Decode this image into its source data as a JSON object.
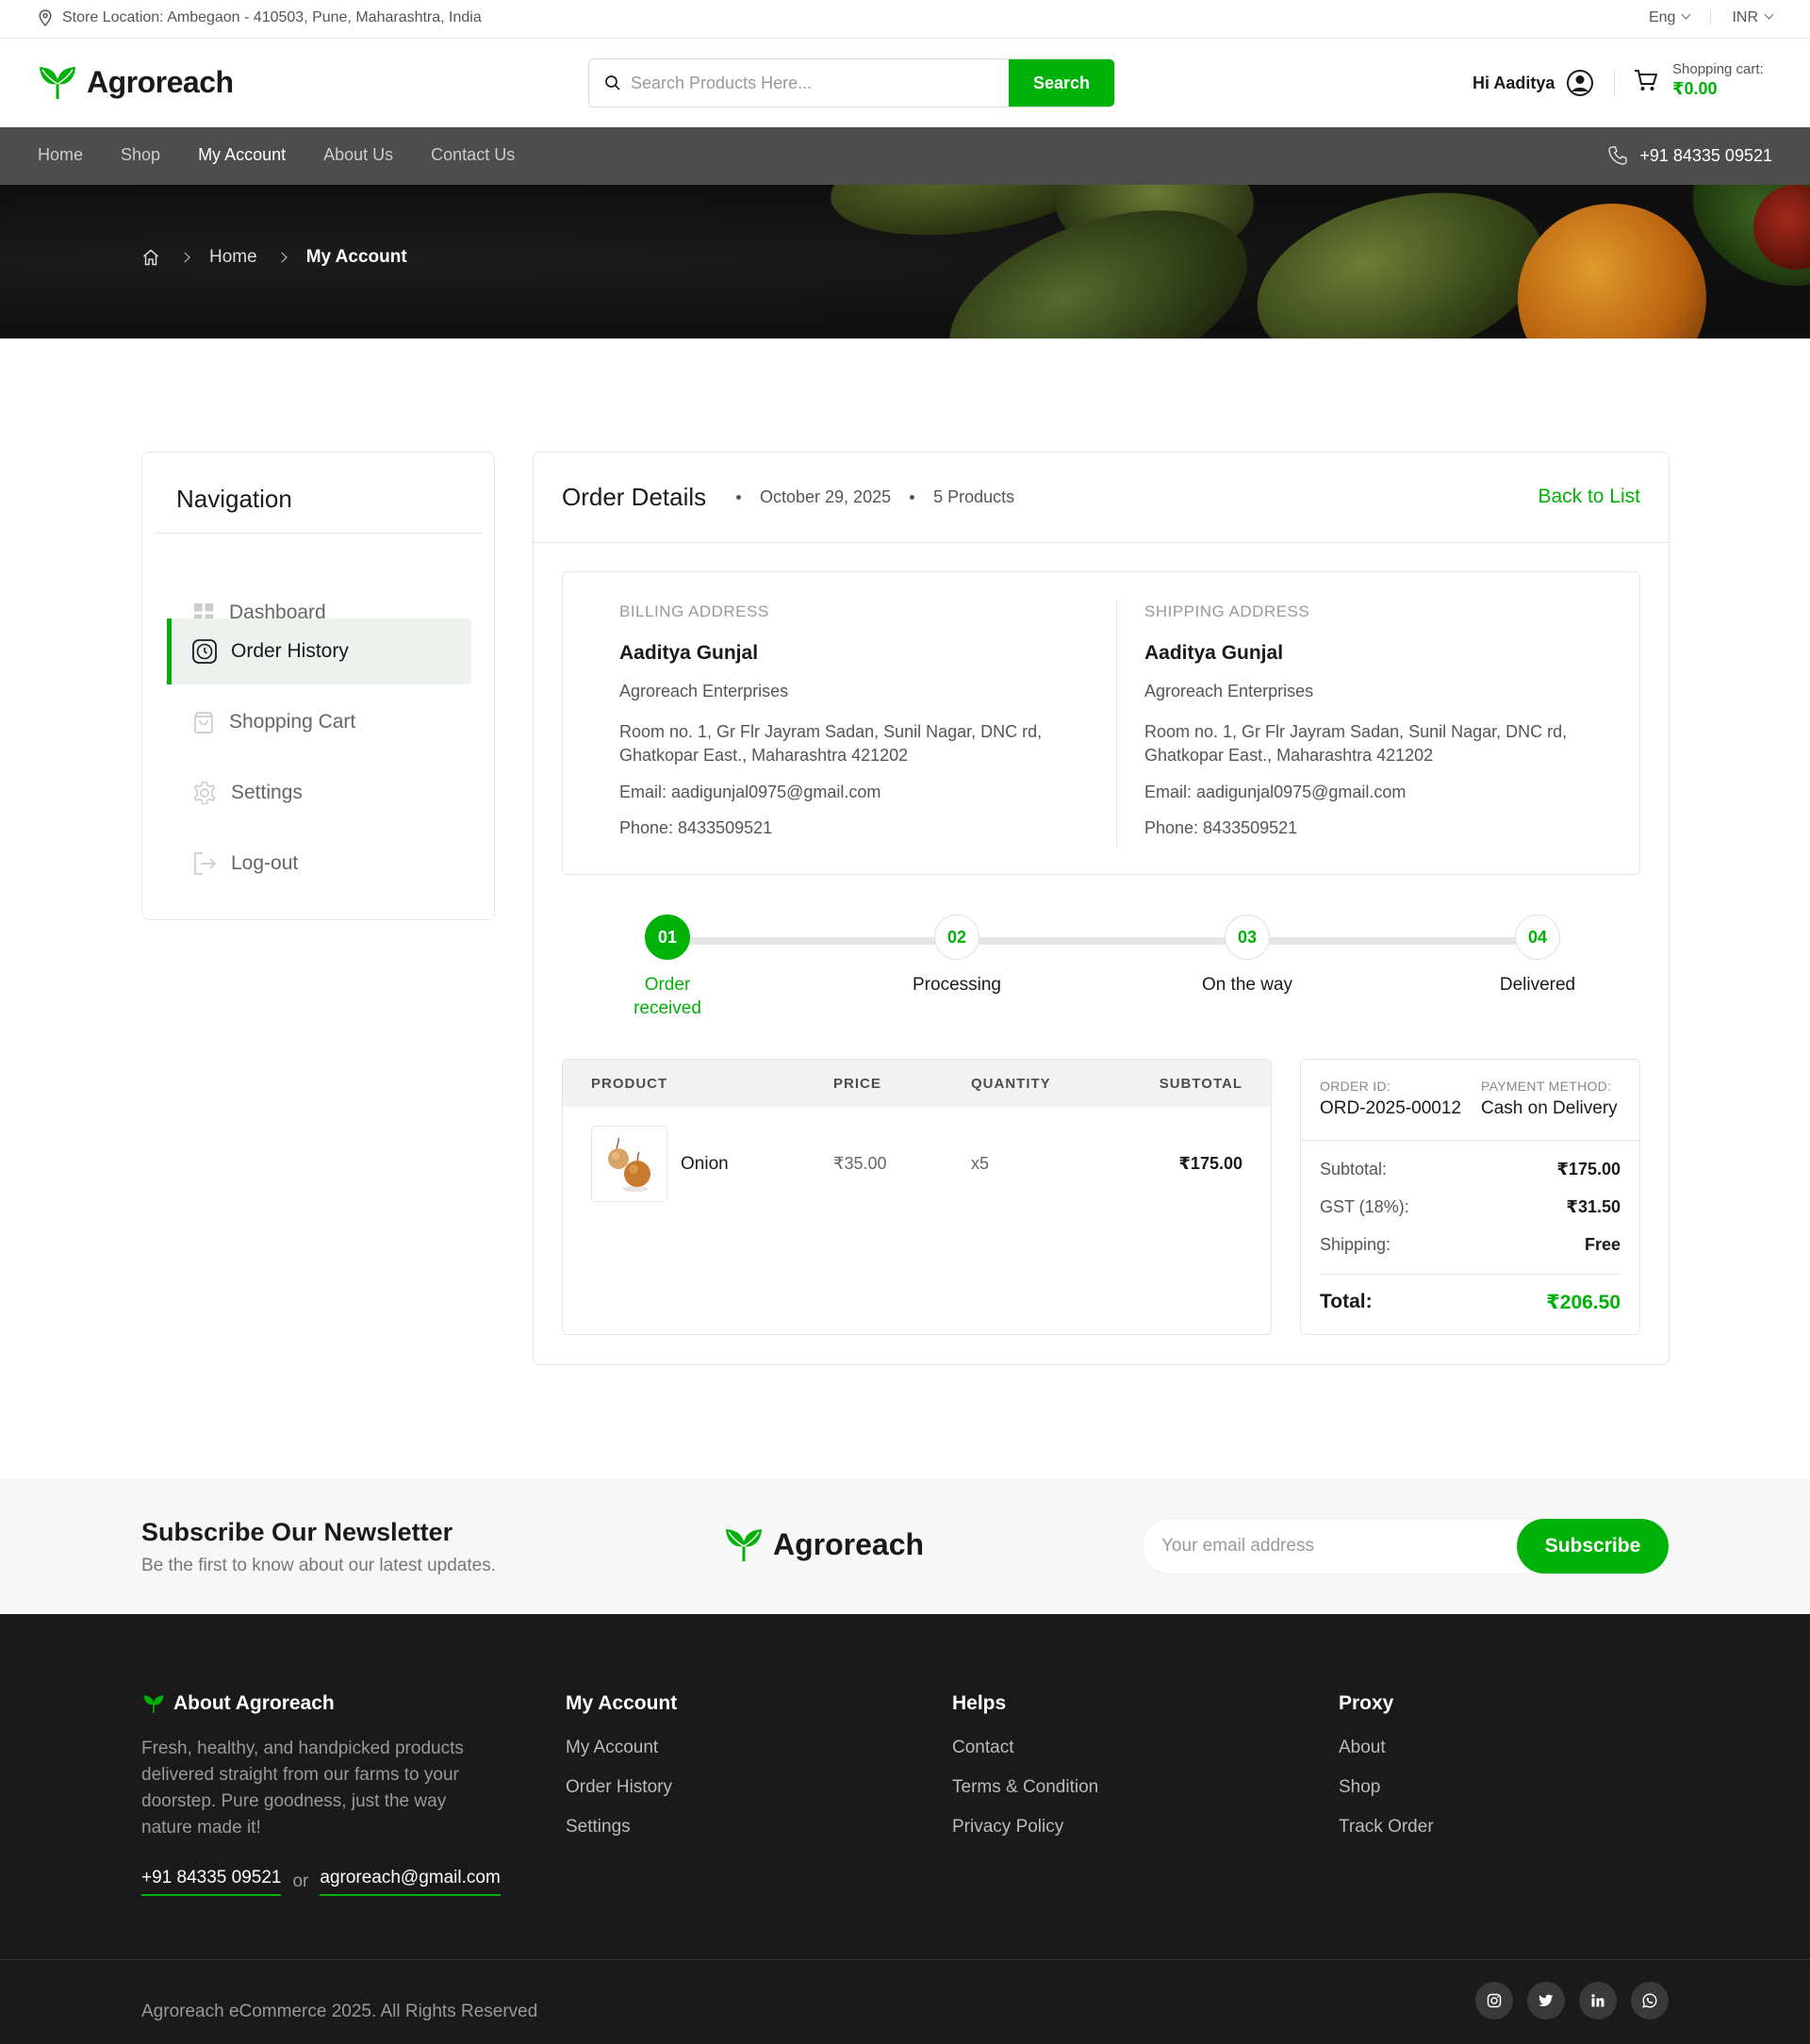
{
  "topbar": {
    "location": "Store Location: Ambegaon - 410503, Pune, Maharashtra, India",
    "language": "Eng",
    "currency": "INR"
  },
  "header": {
    "brand": "Agroreach",
    "search_placeholder": "Search Products Here...",
    "search_button": "Search",
    "greeting": "Hi Aaditya",
    "cart_label": "Shopping cart:",
    "cart_amount": "₹0.00"
  },
  "nav": {
    "links": [
      "Home",
      "Shop",
      "My Account",
      "About Us",
      "Contact Us"
    ],
    "active": "My Account",
    "phone": "+91 84335 09521"
  },
  "breadcrumb": {
    "home": "Home",
    "current": "My Account"
  },
  "sidebar": {
    "title": "Navigation",
    "items": [
      {
        "label": "Dashboard",
        "icon": "dashboard-icon"
      },
      {
        "label": "Order History",
        "icon": "clock-icon",
        "active": true
      },
      {
        "label": "Shopping Cart",
        "icon": "bag-icon"
      },
      {
        "label": "Settings",
        "icon": "gear-icon"
      },
      {
        "label": "Log-out",
        "icon": "logout-icon"
      }
    ]
  },
  "order": {
    "title": "Order Details",
    "date": "October 29, 2025",
    "products_count": "5 Products",
    "back_link": "Back to List",
    "billing": {
      "heading": "BILLING ADDRESS",
      "name": "Aaditya Gunjal",
      "company": "Agroreach Enterprises",
      "address": "Room no. 1, Gr Flr Jayram Sadan, Sunil Nagar, DNC rd, Ghatkopar East., Maharashtra 421202",
      "email": "Email: aadigunjal0975@gmail.com",
      "phone": "Phone: 8433509521"
    },
    "shipping": {
      "heading": "SHIPPING ADDRESS",
      "name": "Aaditya Gunjal",
      "company": "Agroreach Enterprises",
      "address": "Room no. 1, Gr Flr Jayram Sadan, Sunil Nagar, DNC rd, Ghatkopar East., Maharashtra 421202",
      "email": "Email: aadigunjal0975@gmail.com",
      "phone": "Phone: 8433509521"
    },
    "steps": [
      {
        "num": "01",
        "label": "Order received",
        "done": true
      },
      {
        "num": "02",
        "label": "Processing",
        "done": false
      },
      {
        "num": "03",
        "label": "On the way",
        "done": false
      },
      {
        "num": "04",
        "label": "Delivered",
        "done": false
      }
    ],
    "table": {
      "headers": [
        "PRODUCT",
        "PRICE",
        "QUANTITY",
        "SUBTOTAL"
      ],
      "rows": [
        {
          "product": "Onion",
          "price": "₹35.00",
          "quantity": "x5",
          "subtotal": "₹175.00"
        }
      ]
    },
    "summary": {
      "order_id_label": "ORDER ID:",
      "order_id": "ORD-2025-00012",
      "payment_label": "PAYMENT METHOD:",
      "payment": "Cash on Delivery",
      "subtotal_label": "Subtotal:",
      "subtotal": "₹175.00",
      "gst_label": "GST (18%):",
      "gst": "₹31.50",
      "shipping_label": "Shipping:",
      "shipping": "Free",
      "total_label": "Total:",
      "total": "₹206.50"
    }
  },
  "newsletter": {
    "title": "Subscribe Our Newsletter",
    "subtitle": "Be the first to know about our latest updates.",
    "brand": "Agroreach",
    "placeholder": "Your email address",
    "button": "Subscribe"
  },
  "footer": {
    "about_title": "About Agroreach",
    "about_text": "Fresh, healthy, and handpicked products delivered straight from our farms to your doorstep. Pure goodness, just the way nature made it!",
    "phone": "+91 84335 09521",
    "or": "or",
    "email": "agroreach@gmail.com",
    "columns": [
      {
        "title": "My Account",
        "links": [
          "My Account",
          "Order History",
          "Settings"
        ]
      },
      {
        "title": "Helps",
        "links": [
          "Contact",
          "Terms & Condition",
          "Privacy Policy"
        ]
      },
      {
        "title": "Proxy",
        "links": [
          "About",
          "Shop",
          "Track Order"
        ]
      }
    ],
    "copyright": "Agroreach eCommerce 2025. All Rights Reserved",
    "socials": [
      "instagram-icon",
      "twitter-icon",
      "linkedin-icon",
      "whatsapp-icon"
    ]
  },
  "colors": {
    "accent": "#00b207",
    "nav_bg": "#4d4d4d",
    "footer_bg": "#1a1a1a"
  }
}
